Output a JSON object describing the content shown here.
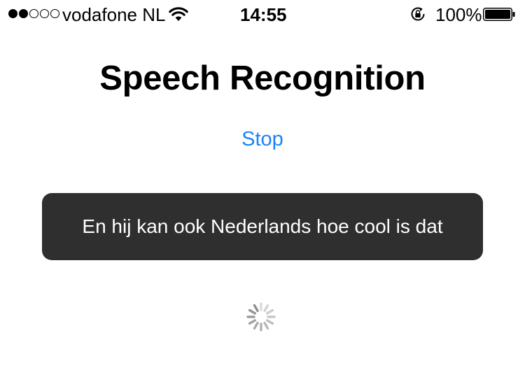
{
  "status_bar": {
    "signal_strength": "2 of 5",
    "carrier": "vodafone NL",
    "wifi_icon": "wifi-icon",
    "time": "14:55",
    "rotation_lock_icon": "rotation-lock-icon",
    "battery_percent": "100%",
    "battery_level": 1.0
  },
  "main": {
    "title": "Speech Recognition",
    "stop_label": "Stop",
    "transcript": "En hij kan ook Nederlands hoe cool is dat",
    "loading_icon": "activity-spinner-icon"
  },
  "colors": {
    "accent": "#1a82fb",
    "transcript_background": "#2f2f2f",
    "transcript_text": "#ffffff",
    "background": "#ffffff"
  }
}
